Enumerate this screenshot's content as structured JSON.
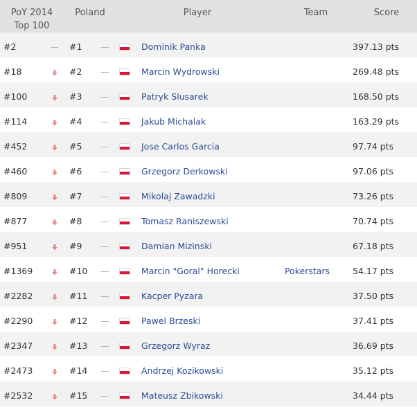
{
  "header": {
    "poy_line1": "PoY 2014",
    "poy_line2": "Top 100",
    "poland": "Poland",
    "player": "Player",
    "team": "Team",
    "score": "Score"
  },
  "colors": {
    "header_bg": "#e2e2e2",
    "row_alt_bg": "#f2f2f2",
    "link": "#2a4c94",
    "trend_down": "#e06666",
    "flag_red": "#dc143c"
  },
  "rows": [
    {
      "rank": "#2",
      "trend": "same",
      "poland_rank": "#1",
      "dash": "—",
      "country_flag": "poland-flag",
      "player": "Dominik Panka",
      "team": "",
      "score": "397.13 pts"
    },
    {
      "rank": "#18",
      "trend": "down",
      "poland_rank": "#2",
      "dash": "—",
      "country_flag": "poland-flag",
      "player": "Marcin Wydrowski",
      "team": "",
      "score": "269.48 pts"
    },
    {
      "rank": "#100",
      "trend": "down",
      "poland_rank": "#3",
      "dash": "—",
      "country_flag": "poland-flag",
      "player": "Patryk Slusarek",
      "team": "",
      "score": "168.50 pts"
    },
    {
      "rank": "#114",
      "trend": "down",
      "poland_rank": "#4",
      "dash": "—",
      "country_flag": "poland-flag",
      "player": "Jakub Michalak",
      "team": "",
      "score": "163.29 pts"
    },
    {
      "rank": "#452",
      "trend": "down",
      "poland_rank": "#5",
      "dash": "—",
      "country_flag": "poland-flag",
      "player": "Jose Carlos Garcia",
      "team": "",
      "score": "97.74 pts"
    },
    {
      "rank": "#460",
      "trend": "down",
      "poland_rank": "#6",
      "dash": "—",
      "country_flag": "poland-flag",
      "player": "Grzegorz Derkowski",
      "team": "",
      "score": "97.06 pts"
    },
    {
      "rank": "#809",
      "trend": "down",
      "poland_rank": "#7",
      "dash": "—",
      "country_flag": "poland-flag",
      "player": "Mikolaj Zawadzki",
      "team": "",
      "score": "73.26 pts"
    },
    {
      "rank": "#877",
      "trend": "down",
      "poland_rank": "#8",
      "dash": "—",
      "country_flag": "poland-flag",
      "player": "Tomasz Raniszewski",
      "team": "",
      "score": "70.74 pts"
    },
    {
      "rank": "#951",
      "trend": "down",
      "poland_rank": "#9",
      "dash": "—",
      "country_flag": "poland-flag",
      "player": "Damian Mizinski",
      "team": "",
      "score": "67.18 pts"
    },
    {
      "rank": "#1369",
      "trend": "down",
      "poland_rank": "#10",
      "dash": "—",
      "country_flag": "poland-flag",
      "player": "Marcin \"Goral\" Horecki",
      "team": "Pokerstars",
      "score": "54.17 pts"
    },
    {
      "rank": "#2282",
      "trend": "down",
      "poland_rank": "#11",
      "dash": "—",
      "country_flag": "poland-flag",
      "player": "Kacper Pyzara",
      "team": "",
      "score": "37.50 pts"
    },
    {
      "rank": "#2290",
      "trend": "down",
      "poland_rank": "#12",
      "dash": "—",
      "country_flag": "poland-flag",
      "player": "Pawel Brzeski",
      "team": "",
      "score": "37.41 pts"
    },
    {
      "rank": "#2347",
      "trend": "down",
      "poland_rank": "#13",
      "dash": "—",
      "country_flag": "poland-flag",
      "player": "Grzegorz Wyraz",
      "team": "",
      "score": "36.69 pts"
    },
    {
      "rank": "#2473",
      "trend": "down",
      "poland_rank": "#14",
      "dash": "—",
      "country_flag": "poland-flag",
      "player": "Andrzej Kozikowski",
      "team": "",
      "score": "35.12 pts"
    },
    {
      "rank": "#2532",
      "trend": "down",
      "poland_rank": "#15",
      "dash": "—",
      "country_flag": "poland-flag",
      "player": "Mateusz Zbikowski",
      "team": "",
      "score": "34.44 pts"
    }
  ]
}
